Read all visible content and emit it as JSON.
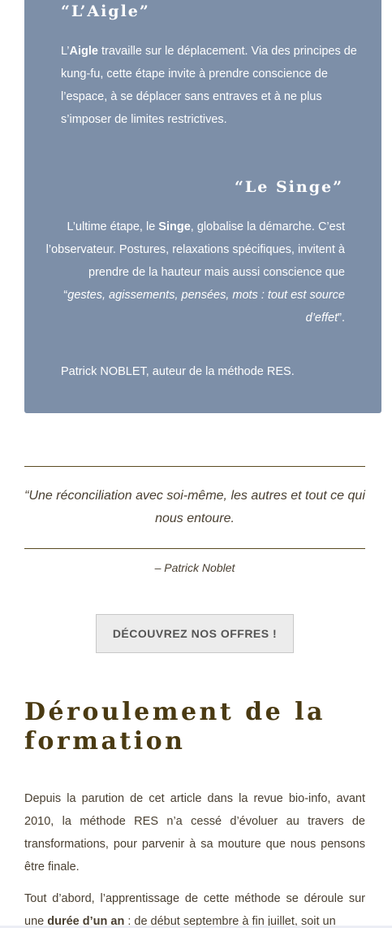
{
  "stages": {
    "aigle": {
      "title": "“L’Aigle”",
      "p_prefix": "L’",
      "p_bold": "Aigle",
      "p_rest": " travaille sur le déplacement. Via des principes de kung-fu, cette étape invite à prendre conscience de l’espace, à se déplacer sans entraves et à ne plus s’imposer de limites restrictives."
    },
    "singe": {
      "title": "“Le Singe”",
      "p_prefix": "L’ultime étape, le ",
      "p_bold": "Singe",
      "p_middle": ", globalise la démarche. C’est l’observateur. Postures, relaxations spécifiques, invitent à prendre de la hauteur mais aussi conscience que “",
      "p_italic": "gestes, agissements, pensées, mots : tout est source d’effet",
      "p_end": "”."
    },
    "author_line": "Patrick NOBLET, auteur de la méthode RES."
  },
  "quote": {
    "text": "“Une réconciliation avec soi-même, les autres et tout ce qui nous entoure.",
    "author": "– Patrick Noblet"
  },
  "cta": {
    "label": "DÉCOUVREZ NOS OFFRES !"
  },
  "section": {
    "heading": "Déroulement de la formation",
    "p1": "Depuis la parution de cet article dans la revue bio-info, avant 2010, la méthode RES n’a cessé d’évoluer au travers de transformations, pour parvenir à sa mouture que nous pensons être finale.",
    "p2_prefix": "Tout d’abord, l’apprentissage de cette méthode se déroule sur une ",
    "p2_bold": "durée d’un an",
    "p2_rest": " : de début septembre à fin juillet, soit un"
  },
  "colors": {
    "box_bg": "#7d8fa8",
    "heading": "#4a3a12",
    "text": "#4a4032"
  }
}
